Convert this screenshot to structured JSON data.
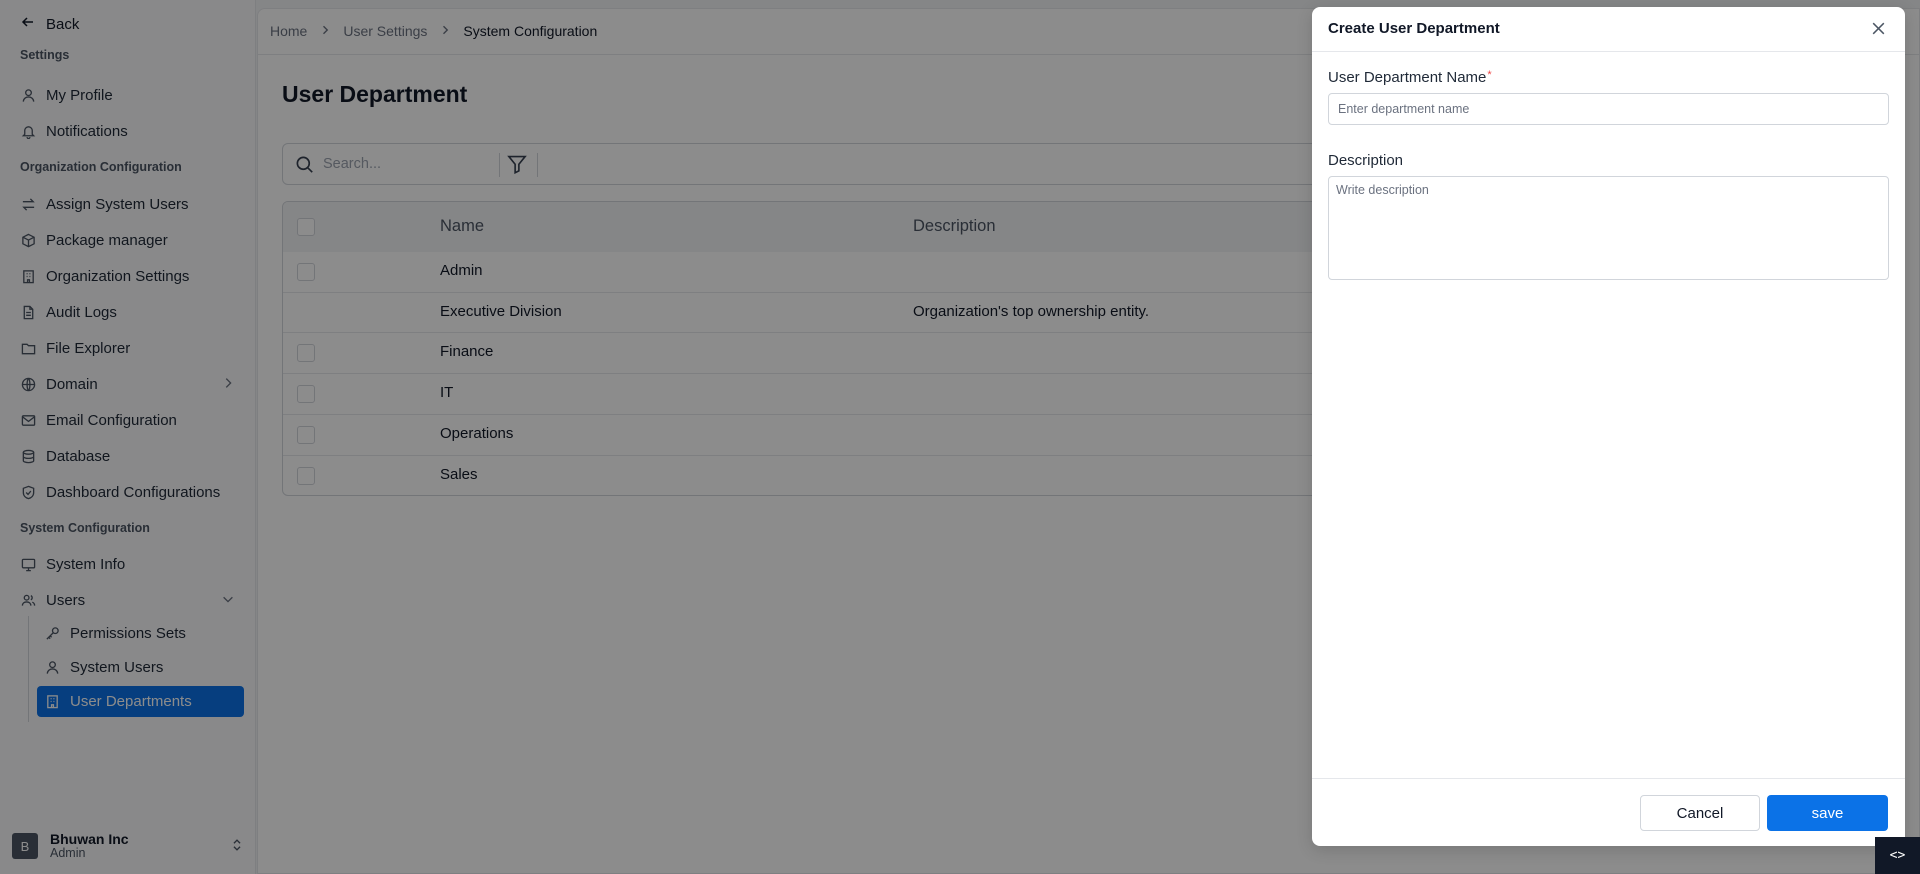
{
  "sidebar": {
    "back_label": "Back",
    "section_settings": "Settings",
    "my_profile": "My Profile",
    "notifications": "Notifications",
    "section_org": "Organization Configuration",
    "assign_system_users": "Assign System Users",
    "package_manager": "Package manager",
    "organization_settings": "Organization Settings",
    "audit_logs": "Audit Logs",
    "file_explorer": "File Explorer",
    "domain": "Domain",
    "email_configuration": "Email Configuration",
    "database": "Database",
    "dashboard_configurations": "Dashboard Configurations",
    "section_system": "System Configuration",
    "system_info": "System Info",
    "users": "Users",
    "permissions_sets": "Permissions Sets",
    "system_users": "System Users",
    "user_departments": "User Departments",
    "org_initial": "B",
    "org_name": "Bhuwan Inc",
    "org_role": "Admin"
  },
  "breadcrumb": {
    "home": "Home",
    "user_settings": "User Settings",
    "current": "System Configuration"
  },
  "page": {
    "title": "User Department",
    "search_placeholder": "Search..."
  },
  "table": {
    "columns": {
      "name": "Name",
      "description": "Description"
    },
    "rows": [
      {
        "name": "Admin",
        "description": ""
      },
      {
        "name": "Executive Division",
        "description": "Organization's top ownership entity."
      },
      {
        "name": "Finance",
        "description": ""
      },
      {
        "name": "IT",
        "description": ""
      },
      {
        "name": "Operations",
        "description": ""
      },
      {
        "name": "Sales",
        "description": ""
      }
    ]
  },
  "drawer": {
    "title": "Create User Department",
    "name_label": "User Department Name",
    "required_mark": "*",
    "name_placeholder": "Enter department name",
    "description_label": "Description",
    "description_placeholder": "Write description",
    "cancel_label": "Cancel",
    "save_label": "save"
  },
  "dev_toggle": "<>",
  "colors": {
    "accent": "#0b72e7",
    "required": "#ef4444",
    "overlay": "rgba(0,0,0,0.45)"
  }
}
